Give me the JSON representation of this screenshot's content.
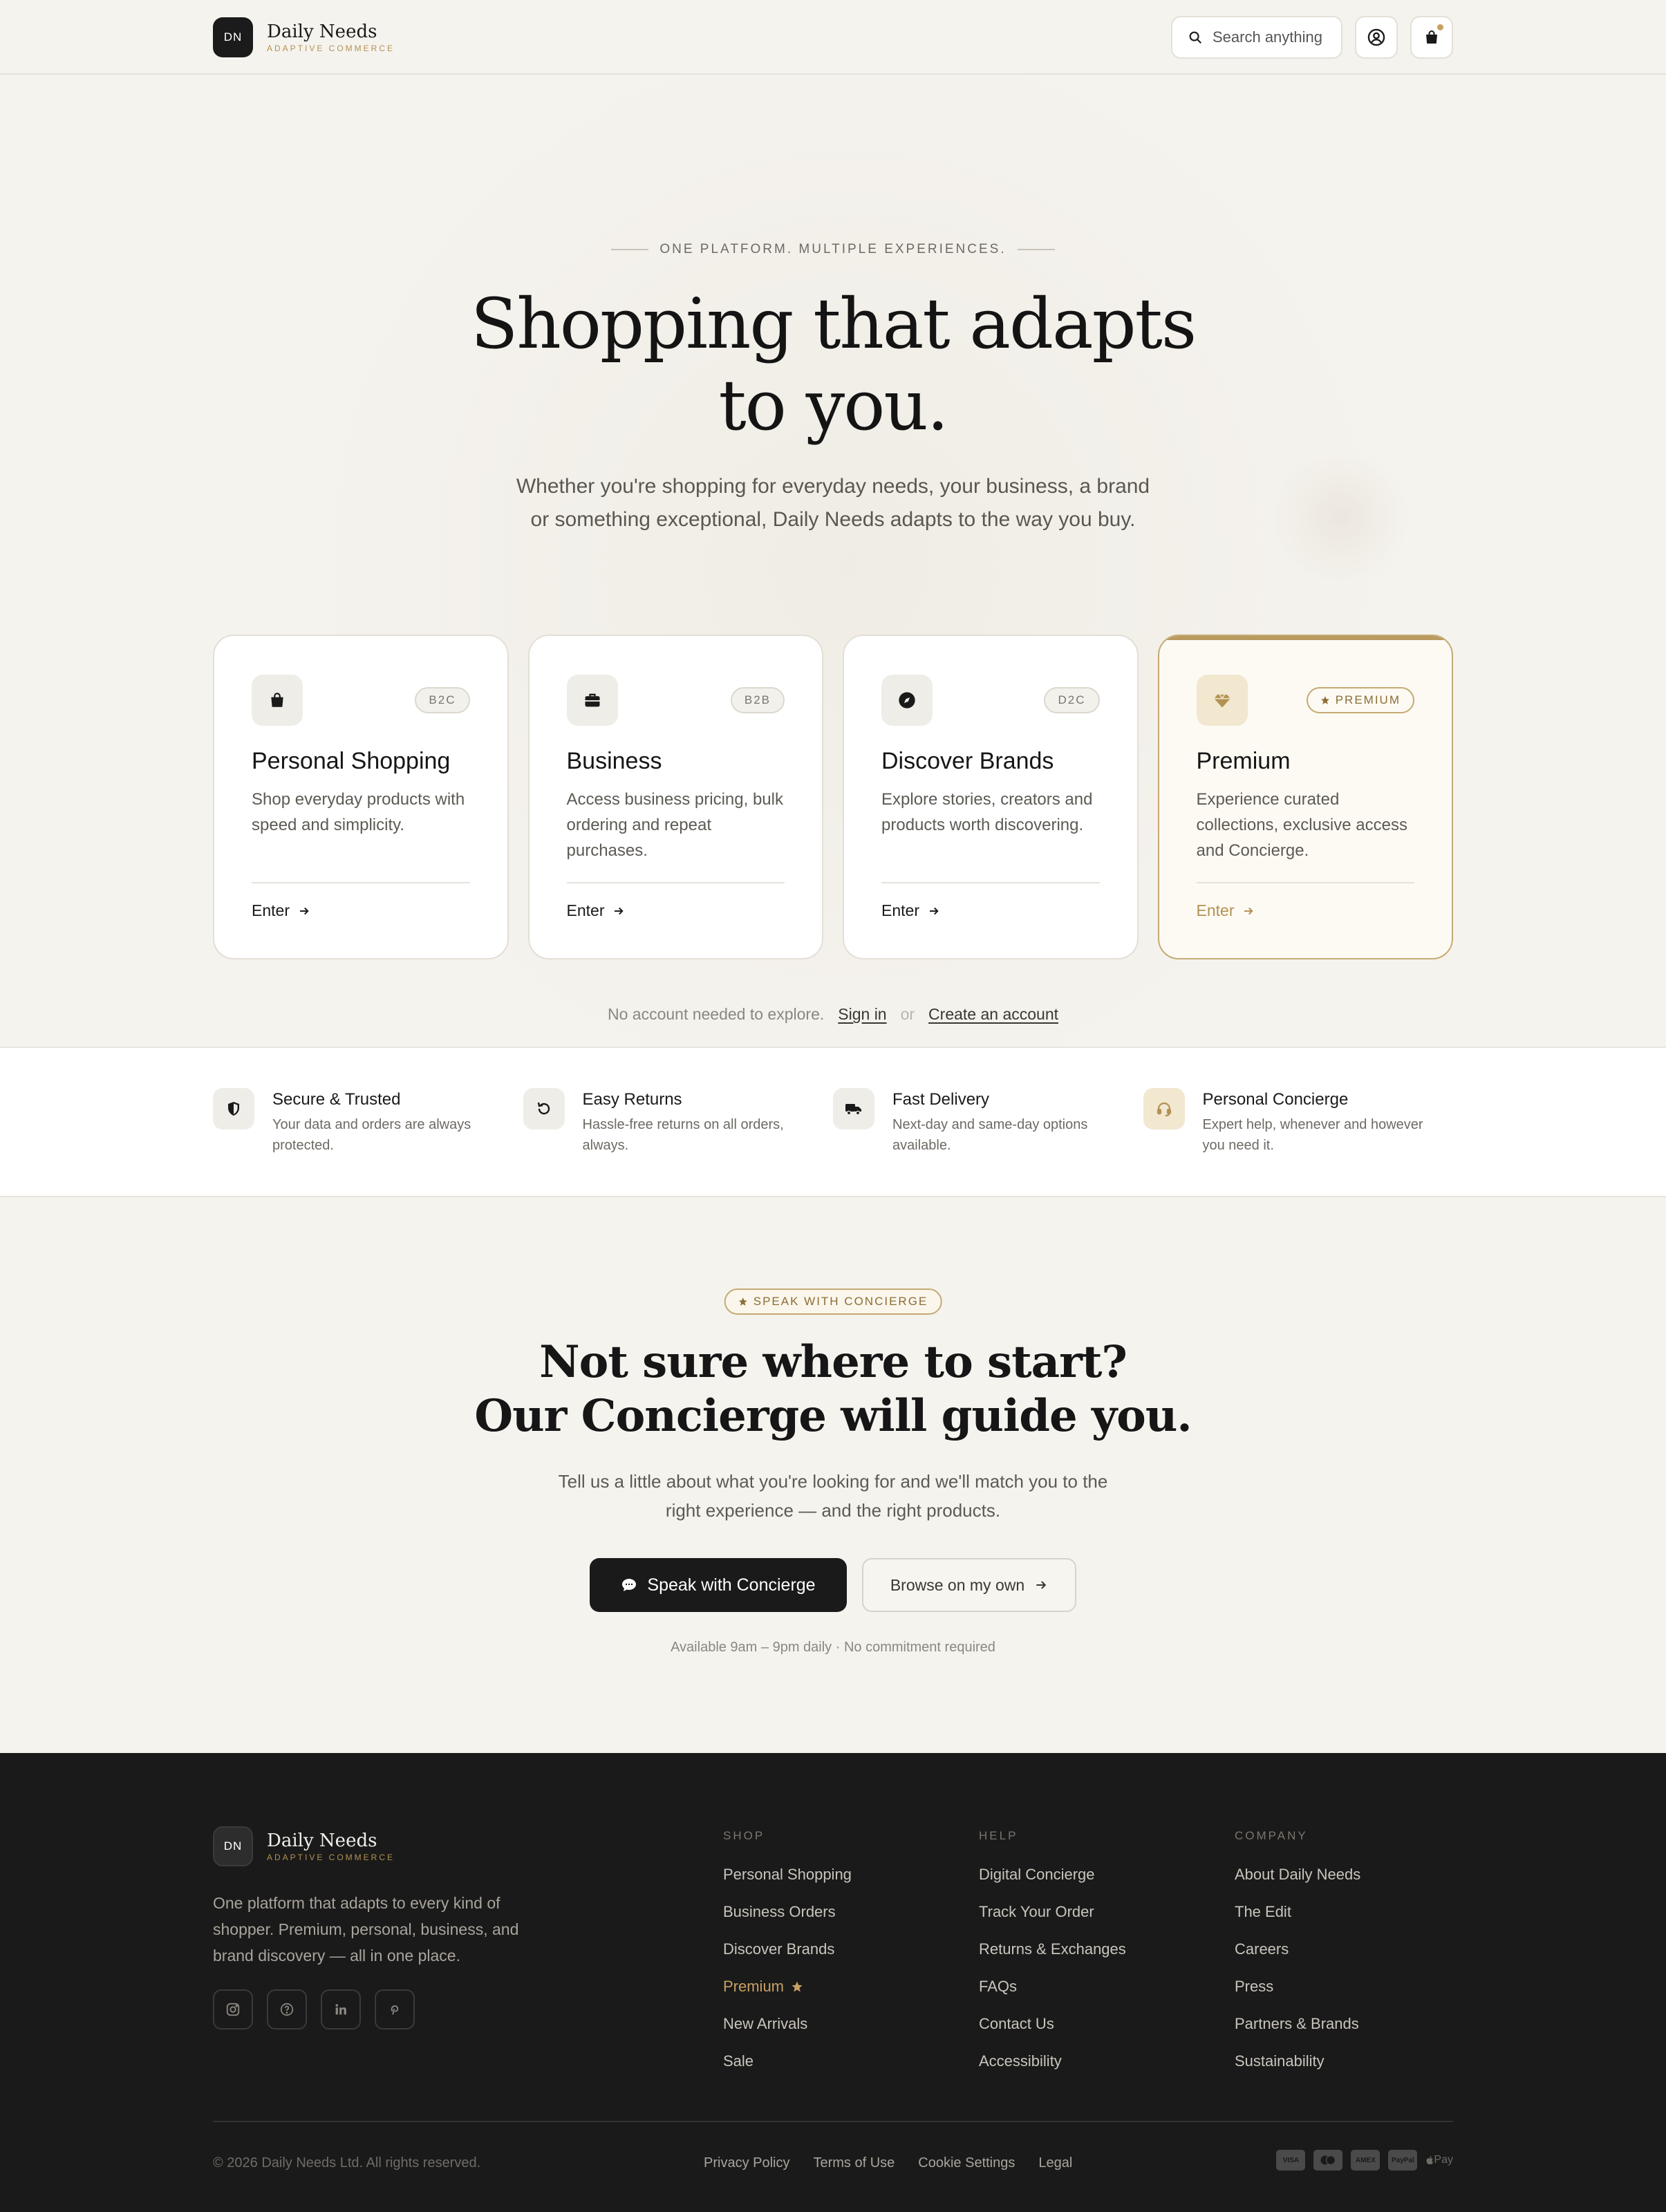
{
  "header": {
    "logo_initials": "DN",
    "brand_name": "Daily Needs",
    "brand_tagline": "ADAPTIVE COMMERCE",
    "search_placeholder": "Search anything",
    "icons": [
      "search-icon",
      "user-icon",
      "shopping-bag-icon"
    ]
  },
  "hero": {
    "eyebrow": "ONE PLATFORM. MULTIPLE EXPERIENCES.",
    "title_line1": "Shopping that adapts",
    "title_line2": "to you.",
    "subtitle": "Whether you're shopping for everyday needs, your business, a brand or something exceptional, Daily Needs adapts to the way you buy.",
    "cards": [
      {
        "tag": "B2C",
        "title": "Personal Shopping",
        "description": "Shop everyday products with speed and simplicity.",
        "cta": "Enter",
        "icon": "shopping-bag-icon"
      },
      {
        "tag": "B2B",
        "title": "Business",
        "description": "Access business pricing, bulk ordering and repeat purchases.",
        "cta": "Enter",
        "icon": "briefcase-icon"
      },
      {
        "tag": "D2C",
        "title": "Discover Brands",
        "description": "Explore stories, creators and products worth discovering.",
        "cta": "Enter",
        "icon": "compass-icon"
      },
      {
        "tag": "PREMIUM",
        "title": "Premium",
        "description": "Experience curated collections, exclusive access and Concierge.",
        "cta": "Enter",
        "icon": "diamond-icon"
      }
    ],
    "note": "No account needed to explore.",
    "sign_in": "Sign in",
    "or": "or",
    "create_account": "Create an account"
  },
  "features": [
    {
      "title": "Secure & Trusted",
      "description": "Your data and orders are always protected.",
      "icon": "shield-icon"
    },
    {
      "title": "Easy Returns",
      "description": "Hassle-free returns on all orders, always.",
      "icon": "return-icon"
    },
    {
      "title": "Fast Delivery",
      "description": "Next-day and same-day options available.",
      "icon": "truck-icon"
    },
    {
      "title": "Personal Concierge",
      "description": "Expert help, whenever and however you need it.",
      "icon": "headset-icon"
    }
  ],
  "concierge": {
    "badge": "SPEAK WITH CONCIERGE",
    "title_line1": "Not sure where to start?",
    "title_line2": "Our Concierge will guide you.",
    "subtitle": "Tell us a little about what you're looking for and we'll match you to the right experience — and the right products.",
    "primary_cta": "Speak with Concierge",
    "secondary_cta": "Browse on my own",
    "note": "Available 9am – 9pm daily · No commitment required"
  },
  "footer": {
    "logo_initials": "DN",
    "brand_name": "Daily Needs",
    "brand_tagline": "ADAPTIVE COMMERCE",
    "about": "One platform that adapts to every kind of shopper. Premium, personal, business, and brand discovery — all in one place.",
    "socials": [
      "instagram-icon",
      "help-icon",
      "linkedin-icon",
      "pinterest-icon"
    ],
    "columns": [
      {
        "title": "SHOP",
        "links": [
          "Personal Shopping",
          "Business Orders",
          "Discover Brands",
          "Premium",
          "New Arrivals",
          "Sale"
        ]
      },
      {
        "title": "HELP",
        "links": [
          "Digital Concierge",
          "Track Your Order",
          "Returns & Exchanges",
          "FAQs",
          "Contact Us",
          "Accessibility"
        ]
      },
      {
        "title": "COMPANY",
        "links": [
          "About Daily Needs",
          "The Edit",
          "Careers",
          "Press",
          "Partners & Brands",
          "Sustainability"
        ]
      }
    ],
    "copyright": "© 2026 Daily Needs Ltd. All rights reserved.",
    "legal": [
      "Privacy Policy",
      "Terms of Use",
      "Cookie Settings",
      "Legal"
    ],
    "payments": [
      "VISA",
      "mastercard",
      "AMEX",
      "PayPal",
      "Pay"
    ]
  },
  "colors": {
    "accent_gold": "#b39152",
    "dark": "#1a1a1a",
    "background": "#f5f3ee"
  }
}
